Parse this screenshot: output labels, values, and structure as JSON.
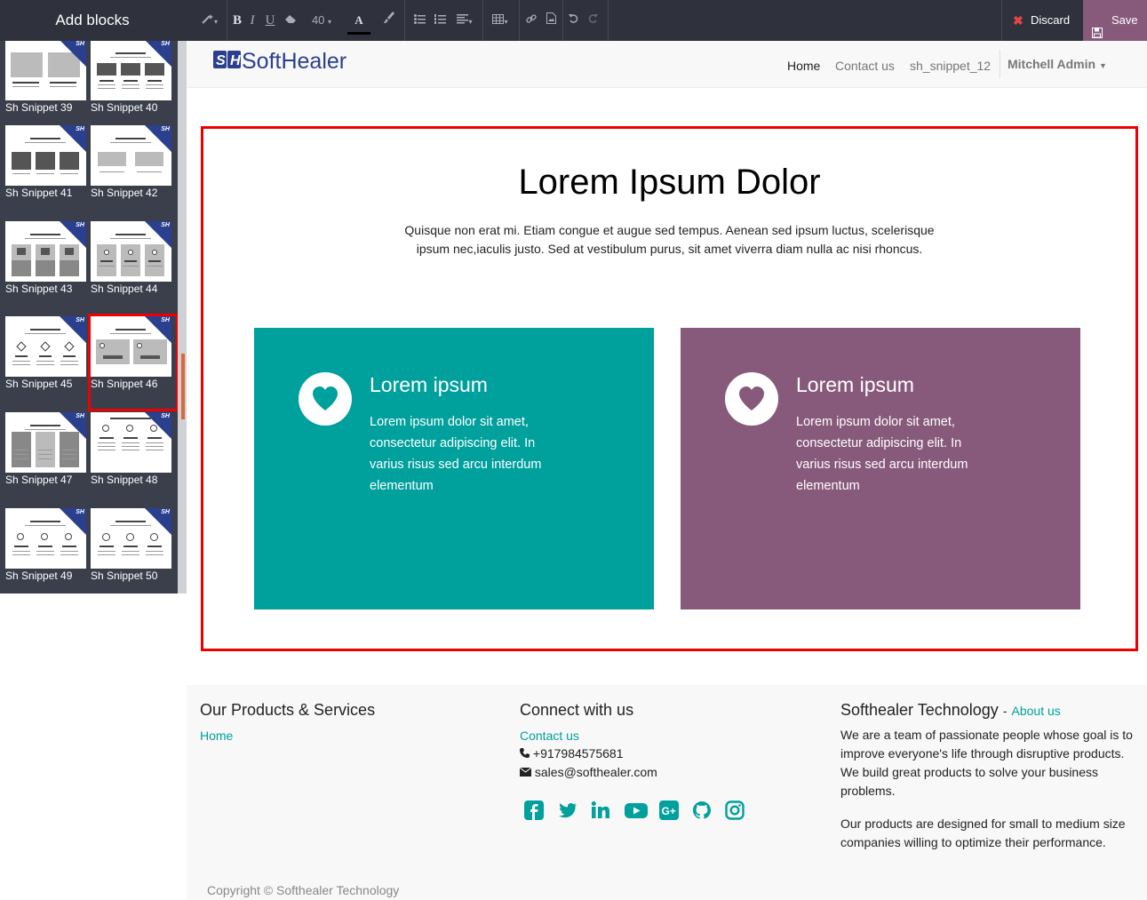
{
  "sidebar": {
    "title": "Add blocks",
    "snippets": [
      "Sh Snippet 39",
      "Sh Snippet 40",
      "Sh Snippet 41",
      "Sh Snippet 42",
      "Sh Snippet 43",
      "Sh Snippet 44",
      "Sh Snippet 45",
      "Sh Snippet 46",
      "Sh Snippet 47",
      "Sh Snippet 48",
      "Sh Snippet 49",
      "Sh Snippet 50"
    ],
    "selected": "Sh Snippet 46"
  },
  "toolbar": {
    "font_size": "40",
    "discard_label": "Discard",
    "save_label": "Save"
  },
  "navbar": {
    "logo_text": "SoftHealer",
    "links": [
      "Home",
      "Contact us",
      "sh_snippet_12"
    ],
    "active": "Home",
    "user": "Mitchell Admin"
  },
  "section": {
    "title": "Lorem Ipsum Dolor",
    "description": "Quisque non erat mi. Etiam congue et augue sed tempus. Aenean sed ipsum luctus, scelerisque ipsum nec,iaculis justo. Sed at vestibulum purus, sit amet viverra diam nulla ac nisi rhoncus.",
    "cards": [
      {
        "title": "Lorem ipsum",
        "text": "Lorem ipsum dolor sit amet, consectetur adipiscing elit. In varius risus sed arcu interdum elementum",
        "color": "#00a09d"
      },
      {
        "title": "Lorem ipsum",
        "text": "Lorem ipsum dolor sit amet, consectetur adipiscing elit. In varius risus sed arcu interdum elementum",
        "color": "#875a7b"
      }
    ]
  },
  "footer": {
    "products_heading": "Our Products & Services",
    "products_link": "Home",
    "connect_heading": "Connect with us",
    "contact_link": "Contact us",
    "phone": "+917984575681",
    "email": "sales@softhealer.com",
    "company_heading": "Softhealer Technology",
    "company_sep": "-",
    "about_link": "About us",
    "about_p1": "We are a team of passionate people whose goal is to improve everyone's life through disruptive products. We build great products to solve your business problems.",
    "about_p2": "Our products are designed for small to medium size companies willing to optimize their performance.",
    "social_icons": [
      "facebook-icon",
      "twitter-icon",
      "linkedin-icon",
      "youtube-icon",
      "google-plus-icon",
      "github-icon",
      "instagram-icon"
    ],
    "copyright": "Copyright © Softhealer Technology"
  }
}
